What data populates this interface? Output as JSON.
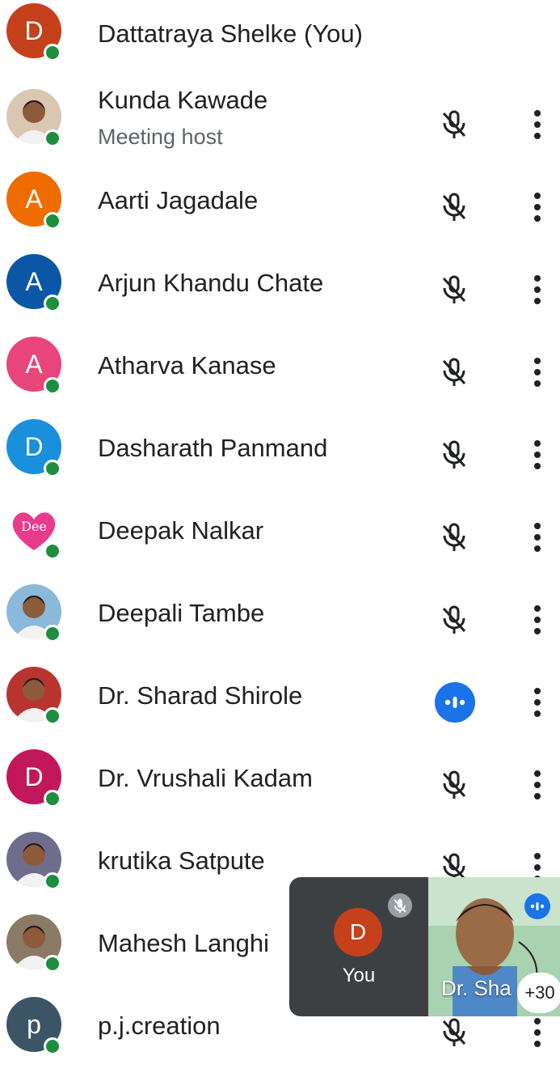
{
  "participants": [
    {
      "name": "Dattatraya Shelke (You)",
      "initial": "D",
      "color": "#c5411b",
      "mic": "none"
    },
    {
      "name": "Kunda Kawade",
      "subtitle": "Meeting host",
      "initial": "",
      "color": "#d9c7b2",
      "mic": "muted",
      "photo": true
    },
    {
      "name": "Aarti Jagadale",
      "initial": "A",
      "color": "#ef6c00",
      "mic": "muted"
    },
    {
      "name": "Arjun Khandu Chate",
      "initial": "A",
      "color": "#0b57a6",
      "mic": "muted"
    },
    {
      "name": "Atharva Kanase",
      "initial": "A",
      "color": "#e8457a",
      "mic": "muted"
    },
    {
      "name": "Dasharath Panmand",
      "initial": "D",
      "color": "#1a8fdc",
      "mic": "muted"
    },
    {
      "name": "Deepak Nalkar",
      "initial": "",
      "color": "#ffffff",
      "mic": "muted",
      "heart": "Dee"
    },
    {
      "name": "Deepali Tambe",
      "initial": "",
      "color": "#8ab9d9",
      "mic": "muted",
      "photo": true
    },
    {
      "name": "Dr. Sharad Shirole",
      "initial": "",
      "color": "#b8352f",
      "mic": "talking",
      "photo": true
    },
    {
      "name": "Dr. Vrushali Kadam",
      "initial": "D",
      "color": "#c2185b",
      "mic": "muted"
    },
    {
      "name": "krutika Satpute",
      "initial": "",
      "color": "#6e6e8c",
      "mic": "muted",
      "photo": true
    },
    {
      "name": "Mahesh Langhi",
      "initial": "",
      "color": "#8a7a66",
      "mic": "muted",
      "photo": true
    },
    {
      "name": "p.j.creation",
      "initial": "p",
      "color": "#3c5566",
      "mic": "muted"
    }
  ],
  "floating": {
    "self_initial": "D",
    "self_label": "You",
    "video_name": "Dr. Sha",
    "more_count": "+30"
  }
}
